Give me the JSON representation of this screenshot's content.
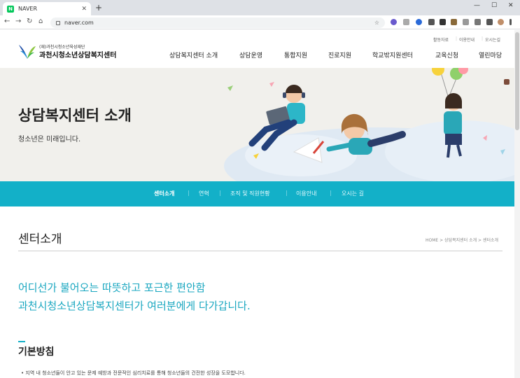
{
  "browser": {
    "tab_title": "NAVER",
    "url": "naver.com",
    "new_tab": "+",
    "back": "←",
    "forward": "→",
    "reload": "↻",
    "home": "⌂",
    "close_tab": "✕",
    "window": {
      "minimize": "—",
      "maximize": "☐",
      "close": "✕"
    }
  },
  "header": {
    "util_links": [
      "활동자료",
      "이용안내",
      "오시는길"
    ],
    "logo_small": "(재)과천시청소년육성재단",
    "logo_main": "과천시청소년상담복지센터",
    "gnb": [
      "상담복지센터 소개",
      "상담운영",
      "통합지원",
      "진로지원",
      "학교밖지원센터",
      "교육신청",
      "열린마당"
    ]
  },
  "hero": {
    "title": "상담복지센터 소개",
    "subtitle": "청소년은 미래입니다."
  },
  "subnav": [
    "센터소개",
    "연혁",
    "조직 및 직원현황",
    "이용안내",
    "오시는 길"
  ],
  "content": {
    "page_title": "센터소개",
    "breadcrumb": "HOME  >  상담복지센터 소개  >  센터소개",
    "lead_line1": "어디선가 불어오는 따뜻하고 포근한 편안함",
    "lead_line2": "과천시청소년상담복지센터가 여러분에게 다가갑니다.",
    "section_title": "기본방침",
    "bullet1": "•  지역 내 청소년들이 안고 있는 문제 예방과 전문적인 심리치료를 통해 청소년들의 건전한 성장을 도모합니다."
  },
  "colors": {
    "accent": "#13b0c8",
    "lead": "#1aa7c0",
    "hero_bg": "#f1f0ec"
  }
}
